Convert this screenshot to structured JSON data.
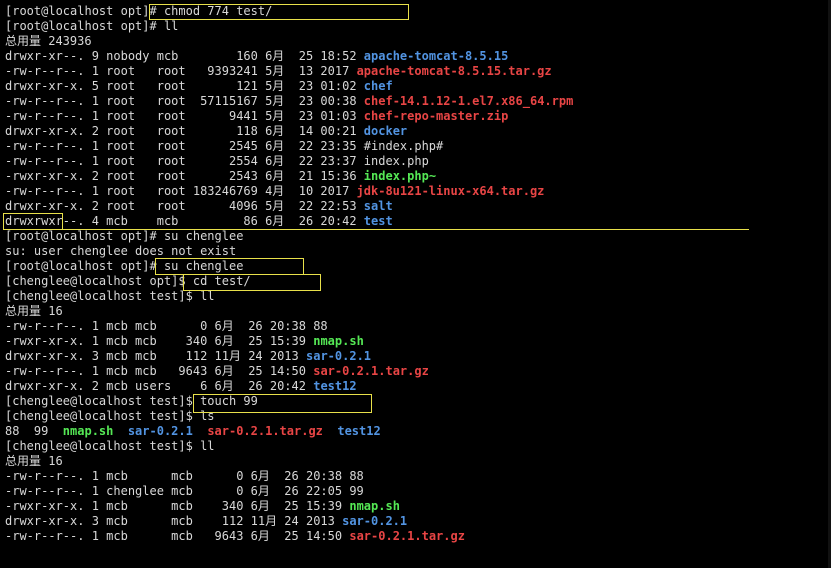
{
  "terminal": {
    "lines": [
      [
        {
          "t": "[root@localhost opt]# chmod 774 test/",
          "c": "txt"
        }
      ],
      [
        {
          "t": "[root@localhost opt]# ll",
          "c": "txt"
        }
      ],
      [
        {
          "t": "总用量 243936",
          "c": "txt"
        }
      ],
      [
        {
          "t": "drwxr-xr--. 9 nobody mcb        160 6月  25 18:52 ",
          "c": "txt"
        },
        {
          "t": "apache-tomcat-8.5.15",
          "c": "dir"
        }
      ],
      [
        {
          "t": "-rw-r--r--. 1 root   root   9393241 5月  13 2017 ",
          "c": "txt"
        },
        {
          "t": "apache-tomcat-8.5.15.tar.gz",
          "c": "arc"
        }
      ],
      [
        {
          "t": "drwxr-xr-x. 5 root   root       121 5月  23 01:02 ",
          "c": "txt"
        },
        {
          "t": "chef",
          "c": "dir"
        }
      ],
      [
        {
          "t": "-rw-r--r--. 1 root   root  57115167 5月  23 00:38 ",
          "c": "txt"
        },
        {
          "t": "chef-14.1.12-1.el7.x86_64.rpm",
          "c": "arc"
        }
      ],
      [
        {
          "t": "-rw-r--r--. 1 root   root      9441 5月  23 01:03 ",
          "c": "txt"
        },
        {
          "t": "chef-repo-master.zip",
          "c": "arc"
        }
      ],
      [
        {
          "t": "drwxr-xr-x. 2 root   root       118 6月  14 00:21 ",
          "c": "txt"
        },
        {
          "t": "docker",
          "c": "dir"
        }
      ],
      [
        {
          "t": "-rw-r--r--. 1 root   root      2545 6月  22 23:35 #index.php#",
          "c": "txt"
        }
      ],
      [
        {
          "t": "-rw-r--r--. 1 root   root      2554 6月  22 23:37 index.php",
          "c": "txt"
        }
      ],
      [
        {
          "t": "-rwxr-xr-x. 2 root   root      2543 6月  21 15:36 ",
          "c": "txt"
        },
        {
          "t": "index.php~",
          "c": "exe"
        }
      ],
      [
        {
          "t": "-rw-r--r--. 1 root   root 183246769 4月  10 2017 ",
          "c": "txt"
        },
        {
          "t": "jdk-8u121-linux-x64.tar.gz",
          "c": "arc"
        }
      ],
      [
        {
          "t": "drwxr-xr-x. 2 root   root      4096 5月  22 22:53 ",
          "c": "txt"
        },
        {
          "t": "salt",
          "c": "dir"
        }
      ],
      [
        {
          "t": "drwxrwxr--. 4 mcb    mcb         86 6月  26 20:42 ",
          "c": "txt"
        },
        {
          "t": "test",
          "c": "dir"
        }
      ],
      [
        {
          "t": "[root@localhost opt]# su chenglee",
          "c": "txt"
        }
      ],
      [
        {
          "t": "su: user chenglee does not exist",
          "c": "txt"
        }
      ],
      [
        {
          "t": "[root@localhost opt]# su chenglee",
          "c": "txt"
        }
      ],
      [
        {
          "t": "[chenglee@localhost opt]$ cd test/",
          "c": "txt"
        }
      ],
      [
        {
          "t": "[chenglee@localhost test]$ ll",
          "c": "txt"
        }
      ],
      [
        {
          "t": "总用量 16",
          "c": "txt"
        }
      ],
      [
        {
          "t": "-rw-r--r--. 1 mcb mcb      0 6月  26 20:38 88",
          "c": "txt"
        }
      ],
      [
        {
          "t": "-rwxr-xr-x. 1 mcb mcb    340 6月  25 15:39 ",
          "c": "txt"
        },
        {
          "t": "nmap.sh",
          "c": "exe"
        }
      ],
      [
        {
          "t": "drwxr-xr-x. 3 mcb mcb    112 11月 24 2013 ",
          "c": "txt"
        },
        {
          "t": "sar-0.2.1",
          "c": "dir"
        }
      ],
      [
        {
          "t": "-rw-r--r--. 1 mcb mcb   9643 6月  25 14:50 ",
          "c": "txt"
        },
        {
          "t": "sar-0.2.1.tar.gz",
          "c": "arc"
        }
      ],
      [
        {
          "t": "drwxr-xr-x. 2 mcb users    6 6月  26 20:42 ",
          "c": "txt"
        },
        {
          "t": "test12",
          "c": "dir"
        }
      ],
      [
        {
          "t": "[chenglee@localhost test]$ touch 99",
          "c": "txt"
        }
      ],
      [
        {
          "t": "[chenglee@localhost test]$ ls",
          "c": "txt"
        }
      ],
      [
        {
          "t": "88  99  ",
          "c": "txt"
        },
        {
          "t": "nmap.sh",
          "c": "exe"
        },
        {
          "t": "  ",
          "c": "txt"
        },
        {
          "t": "sar-0.2.1",
          "c": "dir"
        },
        {
          "t": "  ",
          "c": "txt"
        },
        {
          "t": "sar-0.2.1.tar.gz",
          "c": "arc"
        },
        {
          "t": "  ",
          "c": "txt"
        },
        {
          "t": "test12",
          "c": "dir"
        }
      ],
      [
        {
          "t": "[chenglee@localhost test]$ ll",
          "c": "txt"
        }
      ],
      [
        {
          "t": "总用量 16",
          "c": "txt"
        }
      ],
      [
        {
          "t": "-rw-r--r--. 1 mcb      mcb      0 6月  26 20:38 88",
          "c": "txt"
        }
      ],
      [
        {
          "t": "-rw-r--r--. 1 chenglee mcb      0 6月  26 22:05 99",
          "c": "txt"
        }
      ],
      [
        {
          "t": "-rwxr-xr-x. 1 mcb      mcb    340 6月  25 15:39 ",
          "c": "txt"
        },
        {
          "t": "nmap.sh",
          "c": "exe"
        }
      ],
      [
        {
          "t": "drwxr-xr-x. 3 mcb      mcb    112 11月 24 2013 ",
          "c": "txt"
        },
        {
          "t": "sar-0.2.1",
          "c": "dir"
        }
      ],
      [
        {
          "t": "-rw-r--r--. 1 mcb      mcb   9643 6月  25 14:50 ",
          "c": "txt"
        },
        {
          "t": "sar-0.2.1.tar.gz",
          "c": "arc"
        }
      ]
    ]
  },
  "colors": {
    "background": "#000000",
    "text": "#d8d8d8",
    "directory": "#5294e2",
    "archive": "#e84545",
    "executable": "#55e855",
    "highlight": "#e8e04a"
  }
}
